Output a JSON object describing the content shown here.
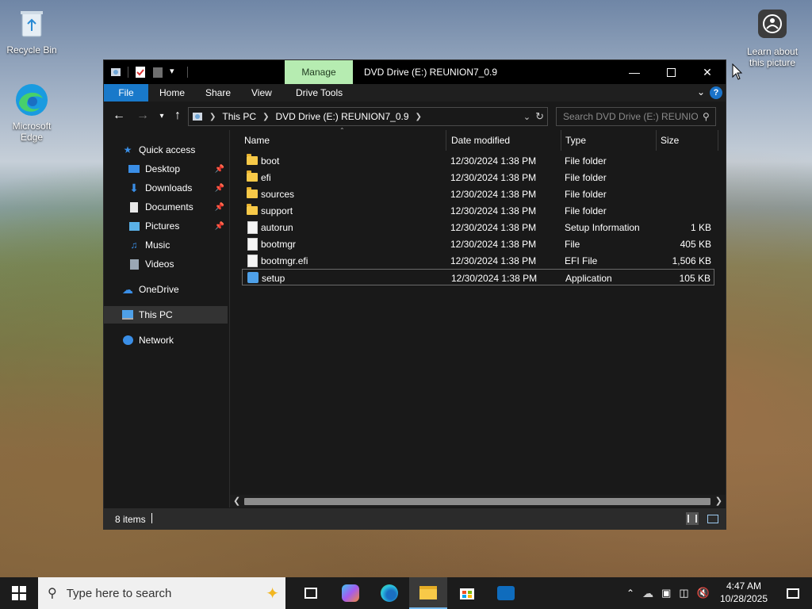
{
  "desktop": {
    "icons": [
      {
        "label": "Recycle Bin"
      },
      {
        "label": "Microsoft Edge"
      },
      {
        "label": "Learn about this picture"
      }
    ]
  },
  "window": {
    "title": "DVD Drive (E:) REUNION7_0.9",
    "manage_tab": "Manage",
    "ribbon_tabs": [
      "File",
      "Home",
      "Share",
      "View",
      "Drive Tools"
    ],
    "address": {
      "crumbs": [
        "This PC",
        "DVD Drive (E:) REUNION7_0.9"
      ]
    },
    "search": {
      "placeholder": "Search DVD Drive (E:) REUNIO..."
    },
    "nav": [
      {
        "label": "Quick access",
        "icon": "star-icon"
      },
      {
        "label": "Desktop",
        "icon": "desktop-icon",
        "pinned": true
      },
      {
        "label": "Downloads",
        "icon": "download-icon",
        "pinned": true
      },
      {
        "label": "Documents",
        "icon": "documents-icon",
        "pinned": true
      },
      {
        "label": "Pictures",
        "icon": "pictures-icon",
        "pinned": true
      },
      {
        "label": "Music",
        "icon": "music-icon"
      },
      {
        "label": "Videos",
        "icon": "videos-icon"
      },
      {
        "label": "OneDrive",
        "icon": "onedrive-icon"
      },
      {
        "label": "This PC",
        "icon": "this-pc-icon"
      },
      {
        "label": "Network",
        "icon": "network-icon"
      }
    ],
    "columns": [
      "Name",
      "Date modified",
      "Type",
      "Size"
    ],
    "files": [
      {
        "name": "boot",
        "date": "12/30/2024 1:38 PM",
        "type": "File folder",
        "size": "",
        "kind": "folder"
      },
      {
        "name": "efi",
        "date": "12/30/2024 1:38 PM",
        "type": "File folder",
        "size": "",
        "kind": "folder"
      },
      {
        "name": "sources",
        "date": "12/30/2024 1:38 PM",
        "type": "File folder",
        "size": "",
        "kind": "folder"
      },
      {
        "name": "support",
        "date": "12/30/2024 1:38 PM",
        "type": "File folder",
        "size": "",
        "kind": "folder"
      },
      {
        "name": "autorun",
        "date": "12/30/2024 1:38 PM",
        "type": "Setup Information",
        "size": "1 KB",
        "kind": "inf"
      },
      {
        "name": "bootmgr",
        "date": "12/30/2024 1:38 PM",
        "type": "File",
        "size": "405 KB",
        "kind": "file"
      },
      {
        "name": "bootmgr.efi",
        "date": "12/30/2024 1:38 PM",
        "type": "EFI File",
        "size": "1,506 KB",
        "kind": "file"
      },
      {
        "name": "setup",
        "date": "12/30/2024 1:38 PM",
        "type": "Application",
        "size": "105 KB",
        "kind": "app",
        "selected": true
      }
    ],
    "status": {
      "count": "8 items"
    }
  },
  "taskbar": {
    "search_placeholder": "Type here to search",
    "apps": [
      "task-view-icon",
      "copilot-icon",
      "edge-icon",
      "file-explorer-icon",
      "store-icon",
      "outlook-icon"
    ],
    "clock": {
      "time": "4:47 AM",
      "date": "10/28/2025"
    }
  },
  "colors": {
    "accent": "#1979ca",
    "manage_tab": "#b6ecb1",
    "window_bg": "#191919",
    "taskbar_bg": "#1c1c1c"
  }
}
